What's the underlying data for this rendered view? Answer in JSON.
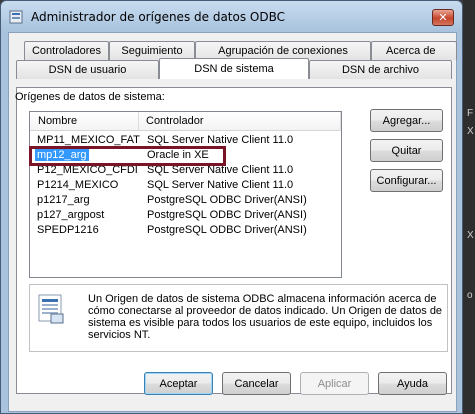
{
  "window": {
    "title": "Administrador de orígenes de datos ODBC",
    "close_label": "✕"
  },
  "tabs_back": [
    "Controladores",
    "Seguimiento",
    "Agrupación de conexiones",
    "Acerca de"
  ],
  "tabs_front": [
    "DSN de usuario",
    "DSN de sistema",
    "DSN de archivo"
  ],
  "active_tab": "DSN de sistema",
  "group_label": "Orígenes de datos de sistema:",
  "list": {
    "columns": [
      "Nombre",
      "Controlador"
    ],
    "rows": [
      [
        "MP11_MEXICO_FAT",
        "SQL Server Native Client 11.0"
      ],
      [
        "mp12_arg",
        "Oracle in XE"
      ],
      [
        "P12_MEXICO_CFDI",
        "SQL Server Native Client 11.0"
      ],
      [
        "P1214_MEXICO",
        "SQL Server Native Client 11.0"
      ],
      [
        "p1217_arg",
        "PostgreSQL ODBC Driver(ANSI)"
      ],
      [
        "p127_argpost",
        "PostgreSQL ODBC Driver(ANSI)"
      ],
      [
        "SPEDP1216",
        "PostgreSQL ODBC Driver(ANSI)"
      ]
    ],
    "selected_index": 1
  },
  "side_buttons": {
    "add": "Agregar...",
    "remove": "Quitar",
    "configure": "Configurar..."
  },
  "info_text": "Un Origen de datos de sistema ODBC almacena información acerca de cómo conectarse al proveedor de datos indicado. Un Origen de datos de sistema es visible para todos los usuarios de este equipo, incluidos los servicios NT.",
  "footer_buttons": {
    "ok": "Aceptar",
    "cancel": "Cancelar",
    "apply": "Aplicar",
    "help": "Ayuda"
  },
  "edge_glyphs": [
    "F",
    "X",
    "X",
    "o"
  ],
  "colors": {
    "selection": "#3399ff",
    "highlight_box": "#7a1528"
  }
}
